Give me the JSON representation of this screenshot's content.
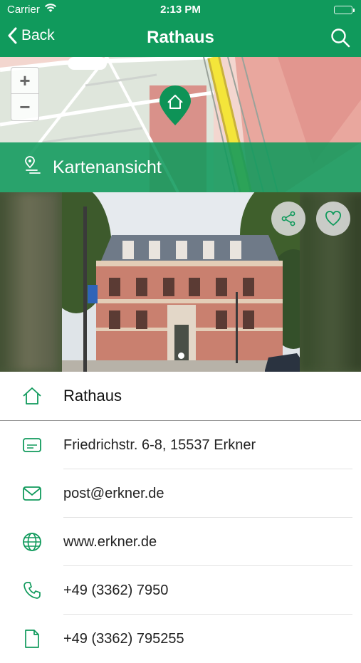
{
  "status_bar": {
    "carrier": "Carrier",
    "time": "2:13 PM"
  },
  "nav": {
    "back_label": "Back",
    "title": "Rathaus"
  },
  "map": {
    "zoom_in": "+",
    "zoom_out": "−",
    "overlay_label": "Kartenansicht"
  },
  "gallery": {
    "photo_count": 1,
    "current_index": 1
  },
  "info": {
    "name": "Rathaus",
    "address": "Friedrichstr. 6-8, 15537 Erkner",
    "email": "post@erkner.de",
    "website": "www.erkner.de",
    "phone": "+49 (3362) 7950",
    "fax": "+49 (3362) 795255"
  },
  "colors": {
    "brand": "#109a5c",
    "icon": "#109a5c",
    "text": "#222222"
  }
}
